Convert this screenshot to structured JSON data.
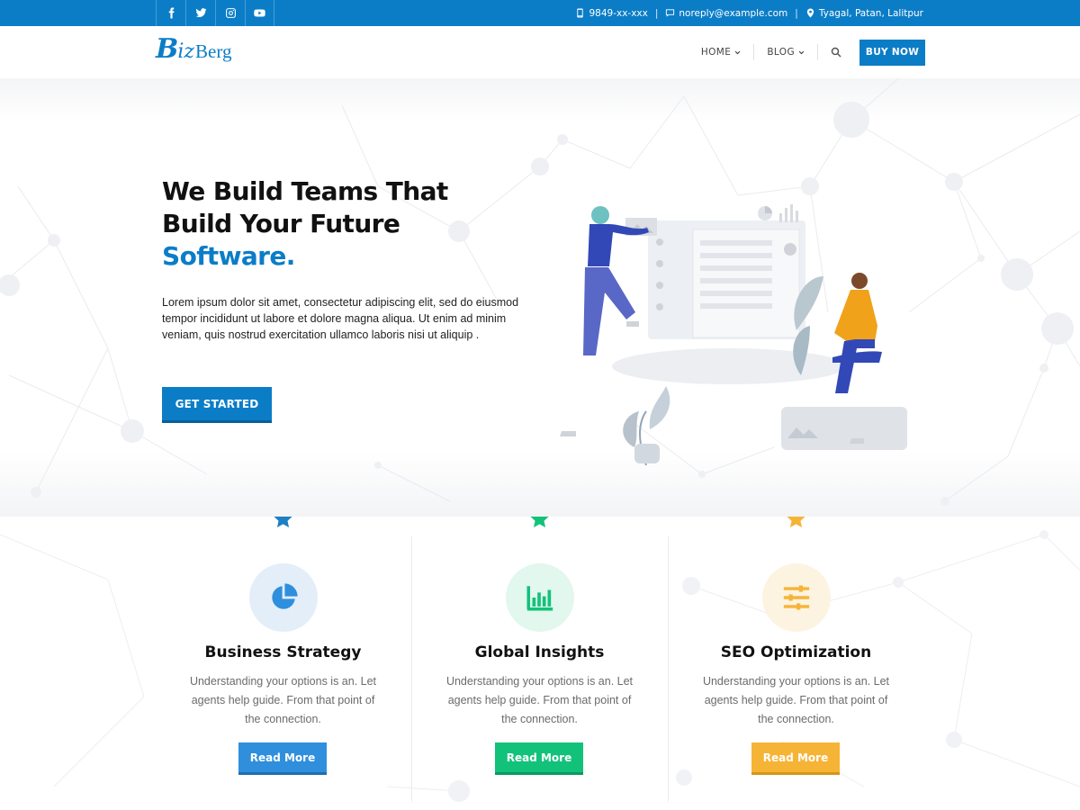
{
  "topbar": {
    "social": [
      {
        "icon": "facebook-icon",
        "glyph": "f"
      },
      {
        "icon": "twitter-icon"
      },
      {
        "icon": "instagram-icon"
      },
      {
        "icon": "youtube-icon"
      }
    ],
    "phone": "9849-xx-xxx",
    "email": "noreply@example.com",
    "location": "Tyagal, Patan, Lalitpur",
    "separator": "|"
  },
  "header": {
    "logo": {
      "part1": "B",
      "part2": "iz",
      "part3": "Berg"
    },
    "nav": {
      "home": "HOME",
      "blog": "BLOG"
    },
    "buy_label": "BUY NOW"
  },
  "hero": {
    "title_line1": "We Build Teams That",
    "title_line2": "Build Your Future",
    "title_accent": "Software.",
    "text": "Lorem ipsum dolor sit amet, consectetur adipiscing elit, sed do eiusmod tempor incididunt ut labore et dolore magna aliqua. Ut enim ad minim veniam, quis nostrud exercitation ullamco laboris nisi ut aliquip .",
    "cta_label": "GET STARTED"
  },
  "features": [
    {
      "title": "Business Strategy",
      "description": "Understanding your options is an. Let agents help guide. From that point of the connection.",
      "button_label": "Read More",
      "icon": "pie-chart-icon",
      "color": "#2f8fdc",
      "tint": "#e3eef9"
    },
    {
      "title": "Global Insights",
      "description": "Understanding your options is an. Let agents help guide. From that point of the connection.",
      "button_label": "Read More",
      "icon": "bar-chart-icon",
      "color": "#13c27a",
      "tint": "#e2f7ee"
    },
    {
      "title": "SEO Optimization",
      "description": "Understanding your options is an. Let agents help guide. From that point of the connection.",
      "button_label": "Read More",
      "icon": "sliders-icon",
      "color": "#f6b436",
      "tint": "#fdf3e1"
    }
  ],
  "colors": {
    "brand": "#0b7dc7",
    "business": "#2f8fdc",
    "insights": "#13c27a",
    "seo": "#f6b436"
  }
}
